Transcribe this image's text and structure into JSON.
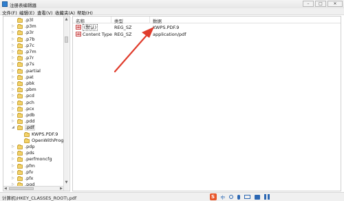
{
  "window": {
    "title": "注册表编辑器",
    "controls": {
      "minimize": "–",
      "maximize": "□",
      "close": "✕"
    }
  },
  "menu": [
    {
      "label": "文件(F)"
    },
    {
      "label": "编辑(E)"
    },
    {
      "label": "查看(V)"
    },
    {
      "label": "收藏夹(A)"
    },
    {
      "label": "帮助(H)"
    }
  ],
  "tree": {
    "items": [
      {
        "label": ".p3l",
        "expandable": false
      },
      {
        "label": ".p3m",
        "expandable": true
      },
      {
        "label": ".p3r",
        "expandable": true
      },
      {
        "label": ".p7b",
        "expandable": true
      },
      {
        "label": ".p7c",
        "expandable": true
      },
      {
        "label": ".p7m",
        "expandable": true
      },
      {
        "label": ".p7r",
        "expandable": true
      },
      {
        "label": ".p7s",
        "expandable": true
      },
      {
        "label": ".partial",
        "expandable": true
      },
      {
        "label": ".pat",
        "expandable": true
      },
      {
        "label": ".pbk",
        "expandable": true
      },
      {
        "label": ".pbm",
        "expandable": true
      },
      {
        "label": ".pcd",
        "expandable": true
      },
      {
        "label": ".pch",
        "expandable": true
      },
      {
        "label": ".pcx",
        "expandable": true
      },
      {
        "label": ".pdb",
        "expandable": true
      },
      {
        "label": ".pdd",
        "expandable": true
      },
      {
        "label": ".pdf",
        "expandable": true,
        "expanded": true,
        "selected": true
      },
      {
        "label": "KWPS.PDF.9",
        "child": true
      },
      {
        "label": "OpenWithProgid",
        "child": true
      },
      {
        "label": ".pdp",
        "expandable": true
      },
      {
        "label": ".pds",
        "expandable": true
      },
      {
        "label": ".perfmoncfg",
        "expandable": true
      },
      {
        "label": ".pfm",
        "expandable": true
      },
      {
        "label": ".pfv",
        "expandable": true
      },
      {
        "label": ".pfx",
        "expandable": true
      },
      {
        "label": ".pgd",
        "expandable": true
      }
    ]
  },
  "list": {
    "columns": {
      "name": "名称",
      "type": "类型",
      "data": "数据"
    },
    "rows": [
      {
        "name": "(默认)",
        "type": "REG_SZ",
        "data": "KWPS.PDF.9",
        "selected": true
      },
      {
        "name": "Content Type",
        "type": "REG_SZ",
        "data": "application/pdf"
      }
    ]
  },
  "annotation": {
    "color": "#e03c2c"
  },
  "status": {
    "path": "计算机\\HKEY_CLASSES_ROOT\\.pdf"
  },
  "tray": {
    "ime_label": "S",
    "ime_mode": "中"
  }
}
